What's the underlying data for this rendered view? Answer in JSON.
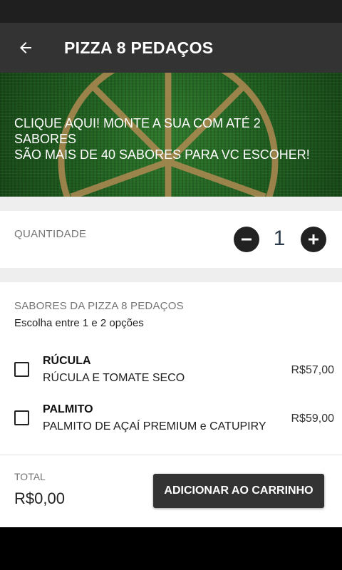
{
  "appbar": {
    "title": "PIZZA 8 PEDAÇOS",
    "back_icon": "arrow-left-icon"
  },
  "banner": {
    "line1": "CLIQUE AQUI!  MONTE A SUA COM ATÉ 2",
    "line2": "SABORES",
    "line3": "SÃO MAIS DE 40 SABORES PARA VC ESCOHER!",
    "background_color": "#1f5d1f"
  },
  "quantity": {
    "label": "QUANTIDADE",
    "value": "1",
    "minus_icon": "minus-icon",
    "plus_icon": "plus-icon"
  },
  "flavors": {
    "title": "SABORES DA PIZZA 8 PEDAÇOS",
    "subtitle": "Escolha entre 1 e 2 opções",
    "options": [
      {
        "name": "RÚCULA",
        "description": "RÚCULA E TOMATE SECO",
        "price": "R$57,00",
        "checked": false
      },
      {
        "name": "PALMITO",
        "description": "PALMITO DE AÇAÍ PREMIUM  e  CATUPIRY",
        "price": "R$59,00",
        "checked": false
      }
    ]
  },
  "footer": {
    "total_label": "TOTAL",
    "total_value": "R$0,00",
    "add_button_label": "ADICIONAR AO CARRINHO"
  },
  "colors": {
    "appbar": "#333333",
    "button": "#333333",
    "section_gap": "#eeeeee"
  }
}
